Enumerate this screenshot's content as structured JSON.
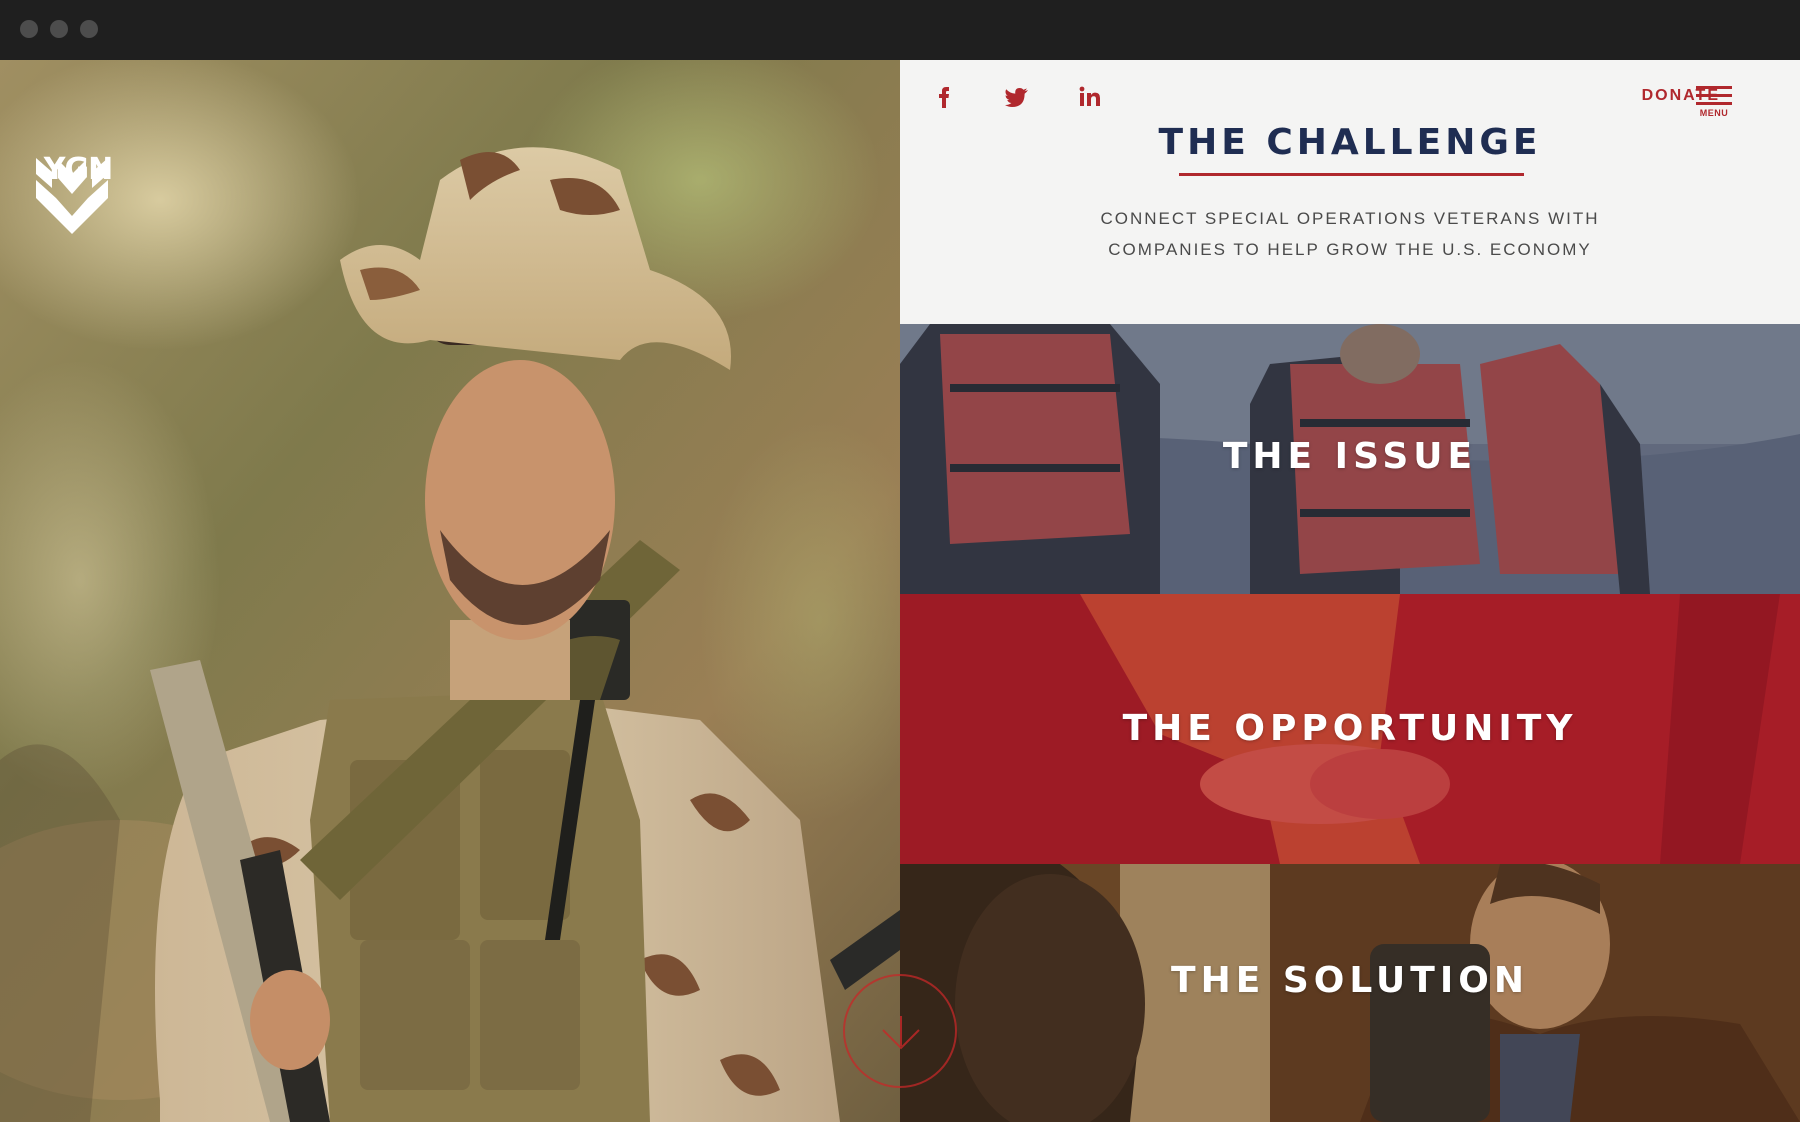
{
  "brand": {
    "logo_text": "YGN"
  },
  "header": {
    "social": [
      {
        "icon": "facebook-icon"
      },
      {
        "icon": "twitter-icon"
      },
      {
        "icon": "linkedin-icon"
      }
    ],
    "donate_label": "DONATE",
    "menu_label": "MENU"
  },
  "challenge": {
    "title": "THE CHALLENGE",
    "subtitle_line1": "CONNECT SPECIAL OPERATIONS VETERANS WITH",
    "subtitle_line2": "COMPANIES TO HELP GROW THE U.S. ECONOMY"
  },
  "tiles": [
    {
      "label": "THE ISSUE"
    },
    {
      "label": "THE OPPORTUNITY"
    },
    {
      "label": "THE SOLUTION"
    }
  ],
  "scroll": {
    "icon": "arrow-down-icon"
  },
  "colors": {
    "accent_red": "#b0282d",
    "navy": "#1f2d52",
    "chrome": "#1f1f1f"
  }
}
